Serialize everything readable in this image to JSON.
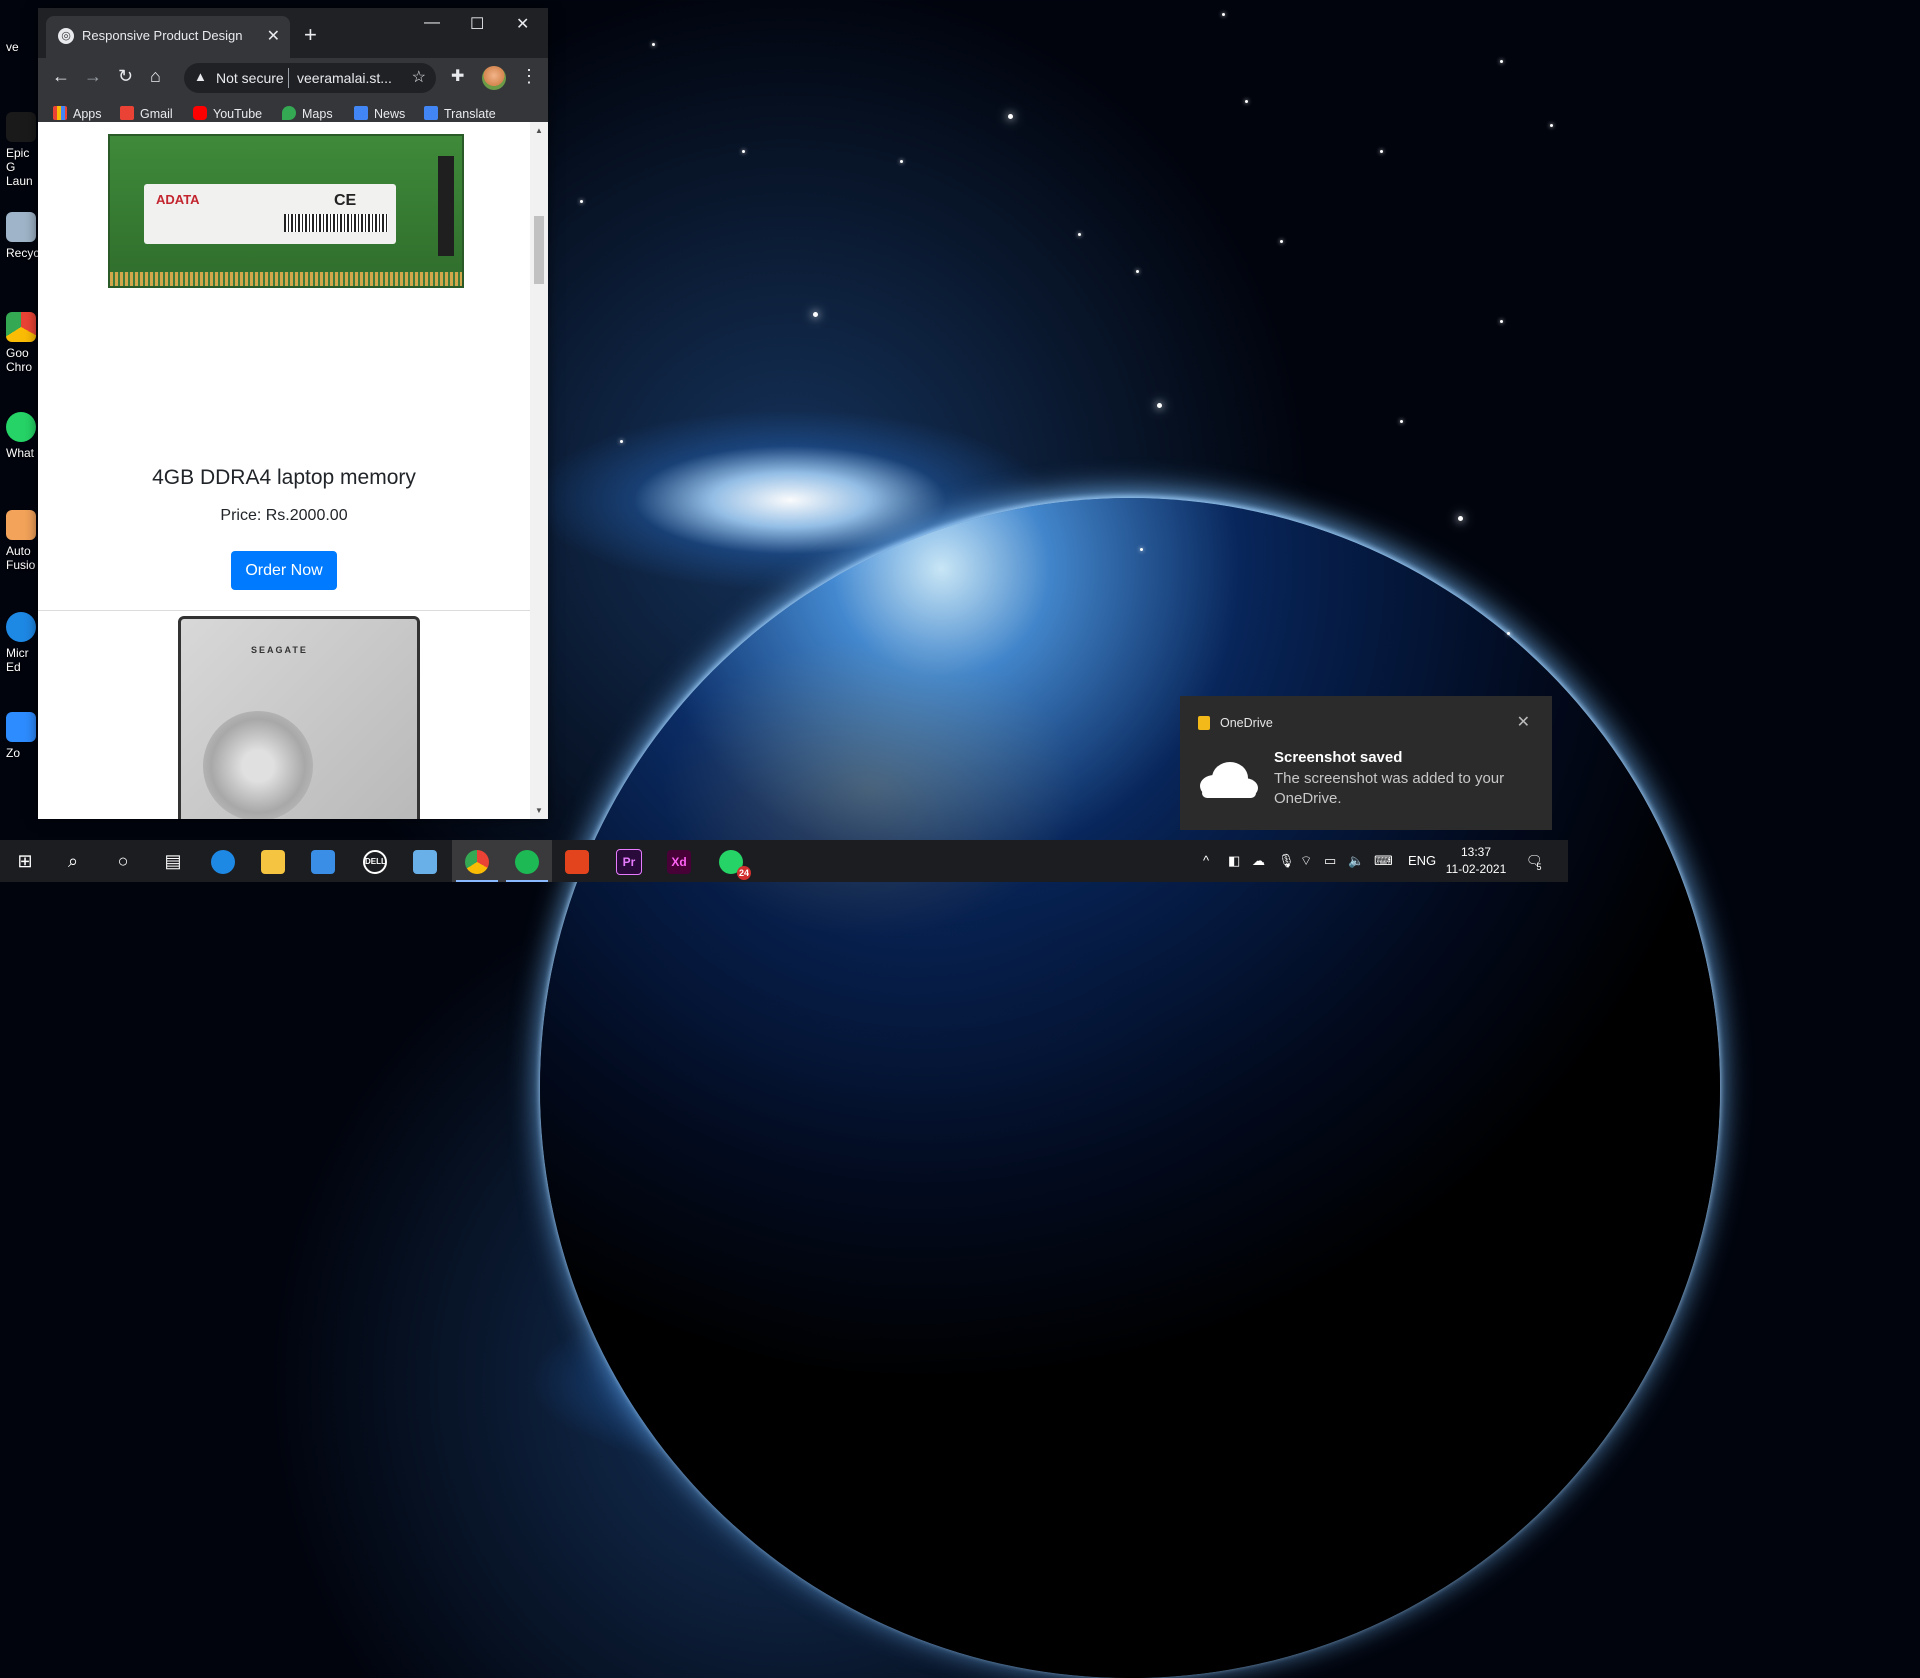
{
  "desktop": {
    "icons": [
      {
        "label": "ve"
      },
      {
        "label": "Epic G Laun"
      },
      {
        "label": "Recyc"
      },
      {
        "label": "Goo Chro"
      },
      {
        "label": "What"
      },
      {
        "label": "Auto Fusio"
      },
      {
        "label": "Micr Ed"
      },
      {
        "label": "Zo"
      }
    ]
  },
  "browser": {
    "tab_title": "Responsive Product Design",
    "omnibox_security": "Not secure",
    "omnibox_url": "veeramalai.st...",
    "bookmarks": [
      "Apps",
      "Gmail",
      "YouTube",
      "Maps",
      "News",
      "Translate"
    ]
  },
  "page": {
    "ram_brand": "ADATA",
    "ram_ce": "CE",
    "product_title": "4GB DDRA4 laptop memory",
    "price": "Price: Rs.2000.00",
    "order_button": "Order Now",
    "hdd_brand": "SEAGATE"
  },
  "toast": {
    "app_name": "OneDrive",
    "heading": "Screenshot saved",
    "body": "The screenshot was added to your OneDrive."
  },
  "taskbar": {
    "apps": [
      "Start",
      "Search",
      "Cortana",
      "Task View",
      "Microsoft Edge",
      "File Explorer",
      "Mail",
      "Dell",
      "Laptop",
      "Google Chrome",
      "Spotify",
      "Office",
      "Pr",
      "Xd",
      "WhatsApp"
    ],
    "whatsapp_badge": "24",
    "language": "ENG",
    "time": "13:37",
    "date": "11-02-2021",
    "notification_count": "5"
  },
  "colors": {
    "order_button": "#007bff",
    "chrome_dark": "#202124",
    "toast_bg": "#2b2b2b"
  }
}
